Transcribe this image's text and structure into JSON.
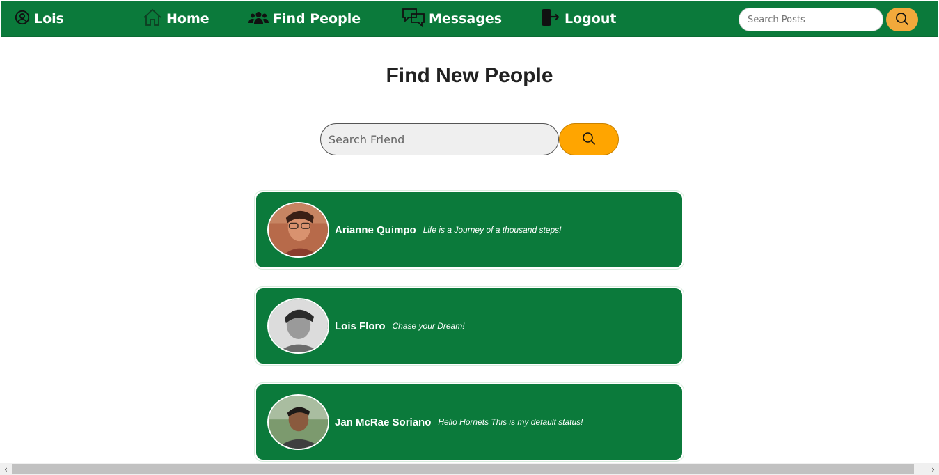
{
  "navbar": {
    "user_label": "Lois",
    "home_label": "Home",
    "find_people_label": "Find People",
    "messages_label": "Messages",
    "logout_label": "Logout",
    "search_placeholder": "Search Posts",
    "bg_color": "#0b7a3b",
    "search_button_color": "#f2a93b"
  },
  "page": {
    "title": "Find New People",
    "search_placeholder": "Search Friend",
    "search_button_color": "#ffa500"
  },
  "people": [
    {
      "name": "Arianne Quimpo",
      "status": "Life is a Journey of a thousand steps!"
    },
    {
      "name": "Lois Floro",
      "status": "Chase your Dream!"
    },
    {
      "name": "Jan McRae Soriano",
      "status": "Hello Hornets This is my default status!"
    }
  ],
  "icons": {
    "user": "user-circle-icon",
    "home": "home-icon",
    "find_people": "users-icon",
    "messages": "chat-bubbles-icon",
    "logout": "logout-door-icon",
    "search": "search-icon"
  }
}
